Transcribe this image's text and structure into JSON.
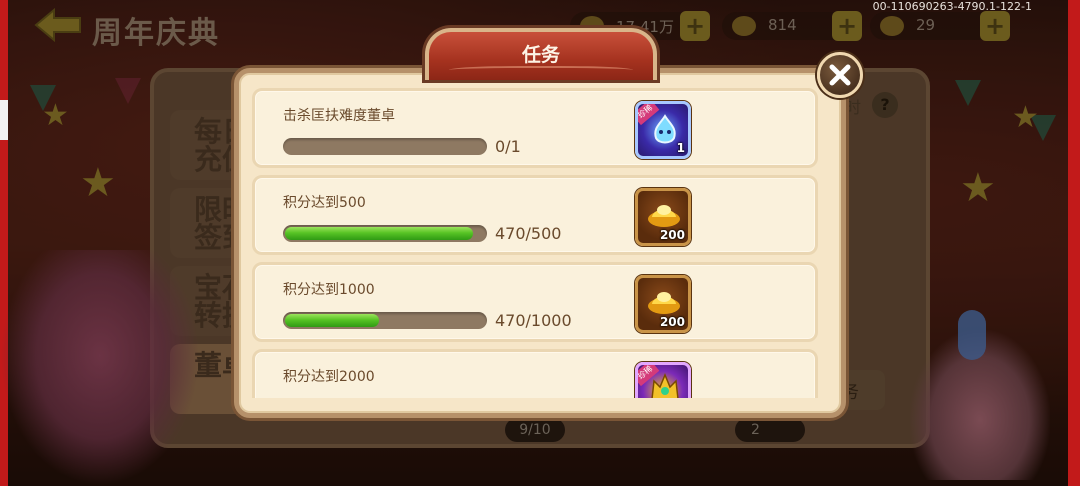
{
  "screen": {
    "page_title": "周年庆典",
    "corner_id": "00-110690263-4790.1-122-1"
  },
  "resources": [
    {
      "name": "coin",
      "value": "17.41万",
      "icon": "coin-icon"
    },
    {
      "name": "ingot",
      "value": "814",
      "icon": "ingot-icon"
    },
    {
      "name": "horn",
      "value": "29",
      "icon": "horn-icon"
    }
  ],
  "background_ui": {
    "side_tabs": [
      {
        "label": "每日充值"
      },
      {
        "label": "限时签到"
      },
      {
        "label": "宝石转换"
      },
      {
        "label": "董卓乱世"
      }
    ],
    "page_indicator": "9/10",
    "page_indicator_2": "2",
    "right_button": "务",
    "time_label": "时"
  },
  "modal": {
    "title": "任务",
    "close_icon": "close-icon",
    "tasks": [
      {
        "title": "击杀匡扶难度董卓",
        "progress_text": "0/1",
        "progress": 0.0,
        "reward": {
          "type": "item",
          "count": "1",
          "tag": "珍稀",
          "color": "#4a6cff"
        }
      },
      {
        "title": "积分达到500",
        "progress_text": "470/500",
        "progress": 0.94,
        "reward": {
          "type": "ingot",
          "count": "200"
        }
      },
      {
        "title": "积分达到1000",
        "progress_text": "470/1000",
        "progress": 0.47,
        "reward": {
          "type": "ingot",
          "count": "200"
        }
      },
      {
        "title": "积分达到2000",
        "progress_text": "",
        "progress": 0.0,
        "reward": {
          "type": "hero",
          "count": "",
          "tag": "珍稀",
          "color": "#8a3acb"
        }
      }
    ]
  }
}
